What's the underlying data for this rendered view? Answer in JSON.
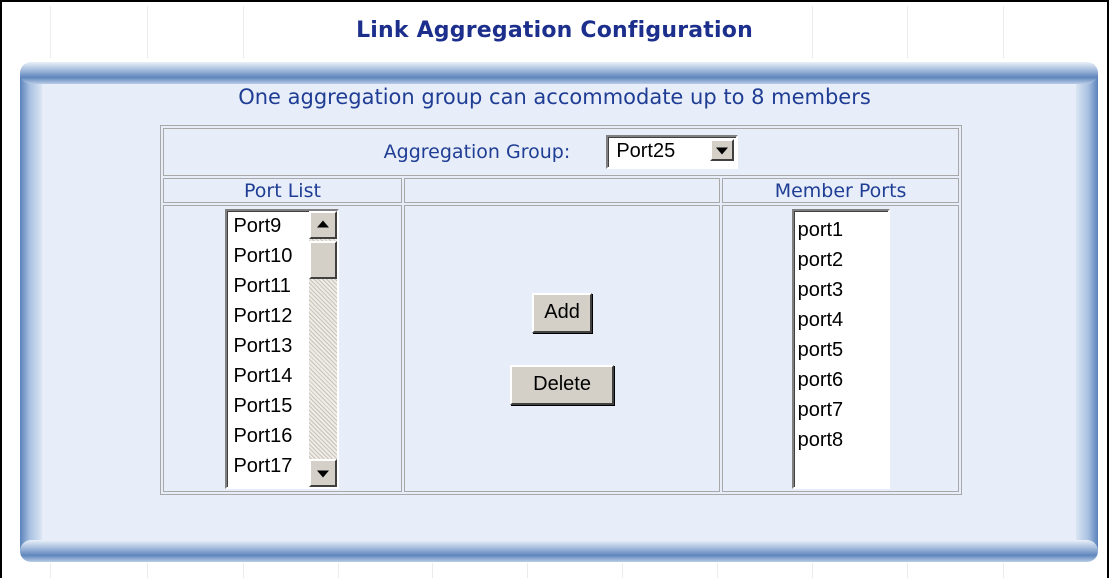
{
  "page": {
    "title": "Link Aggregation Configuration",
    "subtitle": "One aggregation group can accommodate up to 8 members"
  },
  "group": {
    "label": "Aggregation Group:",
    "selected": "Port25"
  },
  "columns": {
    "port_list": "Port List",
    "member_ports": "Member Ports"
  },
  "port_list": {
    "items": [
      "Port9",
      "Port10",
      "Port11",
      "Port12",
      "Port13",
      "Port14",
      "Port15",
      "Port16",
      "Port17"
    ]
  },
  "member_ports": {
    "items": [
      "port1",
      "port2",
      "port3",
      "port4",
      "port5",
      "port6",
      "port7",
      "port8"
    ]
  },
  "actions": {
    "add": "Add",
    "delete": "Delete"
  },
  "colors": {
    "title": "#1c2f8c",
    "text": "#1f3d94",
    "panel_bg": "#e7eef9"
  }
}
